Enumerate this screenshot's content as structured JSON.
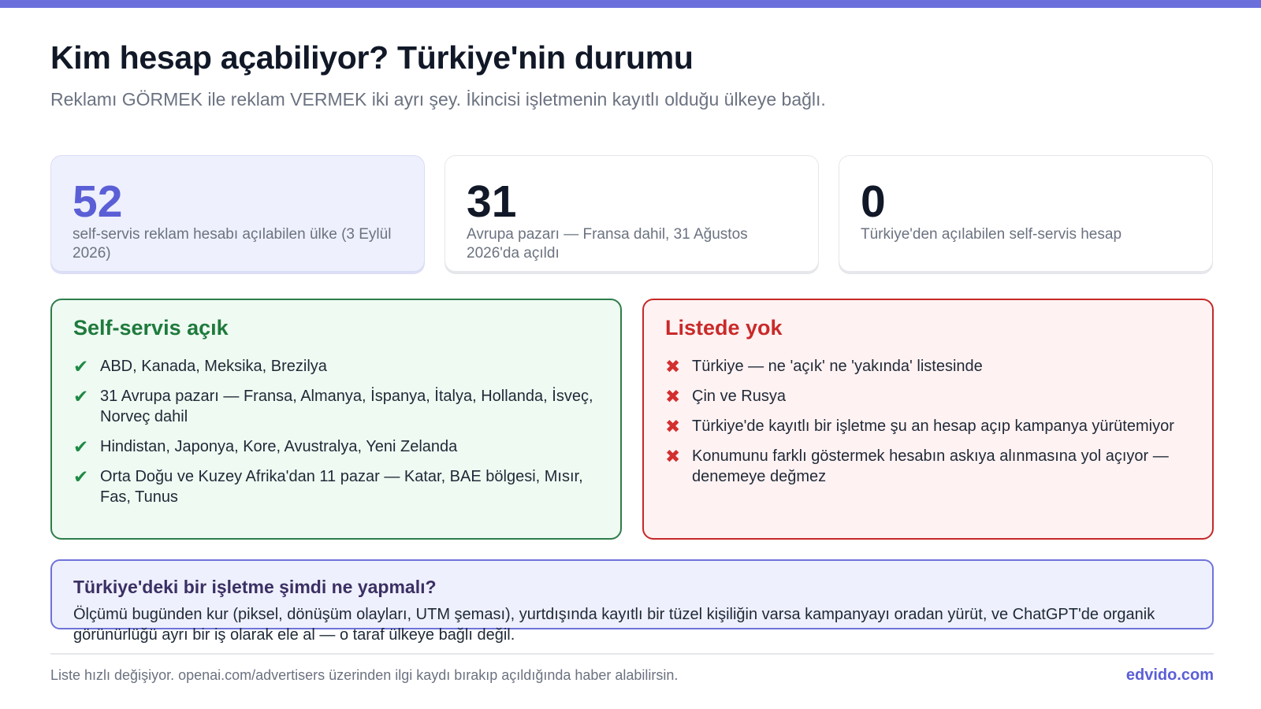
{
  "colors": {
    "accent": "#6b6fdc",
    "brand": "#5b5fd6",
    "success": "#1e8a44",
    "danger": "#d32f2f"
  },
  "header": {
    "title": "Kim hesap açabiliyor? Türkiye'nin durumu",
    "subtitle": "Reklamı GÖRMEK ile reklam VERMEK iki ayrı şey. İkincisi işletmenin kayıtlı olduğu ülkeye bağlı."
  },
  "stats": [
    {
      "value": "52",
      "label": "self-servis reklam hesabı açılabilen ülke (3 Eylül 2026)"
    },
    {
      "value": "31",
      "label": "Avrupa pazarı — Fransa dahil, 31 Ağustos 2026'da açıldı"
    },
    {
      "value": "0",
      "label": "Türkiye'den açılabilen self-servis hesap"
    }
  ],
  "open_panel": {
    "title": "Self-servis açık",
    "icon": "check-icon",
    "items": [
      "ABD, Kanada, Meksika, Brezilya",
      "31 Avrupa pazarı — Fransa, Almanya, İspanya, İtalya, Hollanda, İsveç, Norveç dahil",
      "Hindistan, Japonya, Kore, Avustralya, Yeni Zelanda",
      "Orta Doğu ve Kuzey Afrika'dan 11 pazar — Katar, BAE bölgesi, Mısır, Fas, Tunus"
    ]
  },
  "closed_panel": {
    "title": "Listede yok",
    "icon": "cross-icon",
    "items": [
      "Türkiye — ne 'açık' ne 'yakında' listesinde",
      "Çin ve Rusya",
      "Türkiye'de kayıtlı bir işletme şu an hesap açıp kampanya yürütemiyor",
      "Konumunu farklı göstermek hesabın askıya alınmasına yol açıyor — denemeye değmez"
    ]
  },
  "callout": {
    "title": "Türkiye'deki bir işletme şimdi ne yapmalı?",
    "body": "Ölçümü bugünden kur (piksel, dönüşüm olayları, UTM şeması), yurtdışında kayıtlı bir tüzel kişiliğin varsa kampanyayı oradan yürüt, ve ChatGPT'de organik görünürlüğü ayrı bir iş olarak ele al — o taraf ülkeye bağlı değil."
  },
  "footer": {
    "note": "Liste hızlı değişiyor. openai.com/advertisers üzerinden ilgi kaydı bırakıp açıldığında haber alabilirsin.",
    "brand": "edvido.com"
  }
}
